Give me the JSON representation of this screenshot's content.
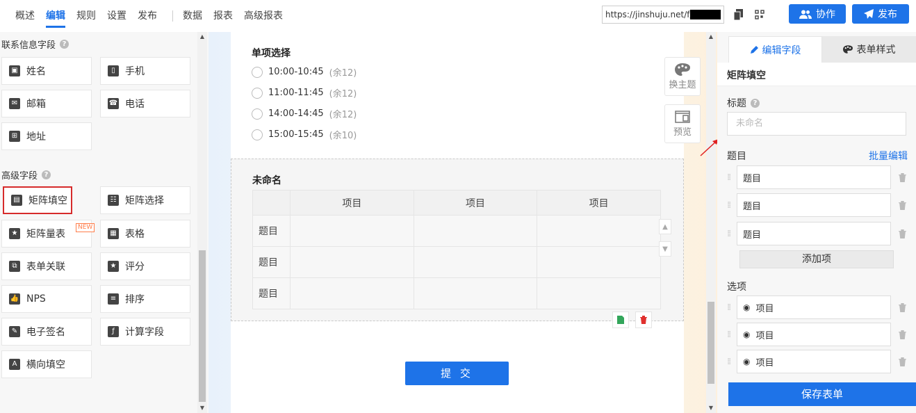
{
  "nav": {
    "items": [
      "概述",
      "编辑",
      "规则",
      "设置",
      "发布"
    ],
    "active": "编辑",
    "items2": [
      "数据",
      "报表",
      "高级报表"
    ]
  },
  "toolbar": {
    "url": "https://jinshuju.net/f/u",
    "collab_label": "协作",
    "publish_label": "发布",
    "copy_icon": "copy-icon",
    "qrcode_icon": "qrcode-icon",
    "accent_color": "#1e73e8"
  },
  "left": {
    "contact_title": "联系信息字段",
    "contact_fields": [
      "姓名",
      "手机",
      "邮箱",
      "电话",
      "地址"
    ],
    "advanced_title": "高级字段",
    "advanced_fields": [
      "矩阵填空",
      "矩阵选择",
      "矩阵量表",
      "表格",
      "表单关联",
      "评分",
      "NPS",
      "排序",
      "电子签名",
      "计算字段",
      "横向填空"
    ],
    "new_badge": "NEW"
  },
  "canvas": {
    "q1": {
      "title": "单项选择",
      "options": [
        {
          "time": "10:00-10:45",
          "remain": "(余12)"
        },
        {
          "time": "11:00-11:45",
          "remain": "(余12)"
        },
        {
          "time": "14:00-14:45",
          "remain": "(余12)"
        },
        {
          "time": "15:00-15:45",
          "remain": "(余10)"
        }
      ]
    },
    "q2": {
      "title": "未命名",
      "columns": [
        "项目",
        "项目",
        "项目"
      ],
      "rows": [
        "题目",
        "题目",
        "题目"
      ]
    },
    "submit_label": "提 交",
    "theme_label": "换主题",
    "preview_label": "预览"
  },
  "right": {
    "tab_edit": "编辑字段",
    "tab_style": "表单样式",
    "field_type": "矩阵填空",
    "title_label": "标题",
    "title_placeholder": "未命名",
    "questions_label": "题目",
    "batch_edit": "批量编辑",
    "questions": [
      "题目",
      "题目",
      "题目"
    ],
    "add_item": "添加项",
    "options_label": "选项",
    "options": [
      "项目",
      "项目",
      "项目"
    ],
    "save_label": "保存表单"
  }
}
